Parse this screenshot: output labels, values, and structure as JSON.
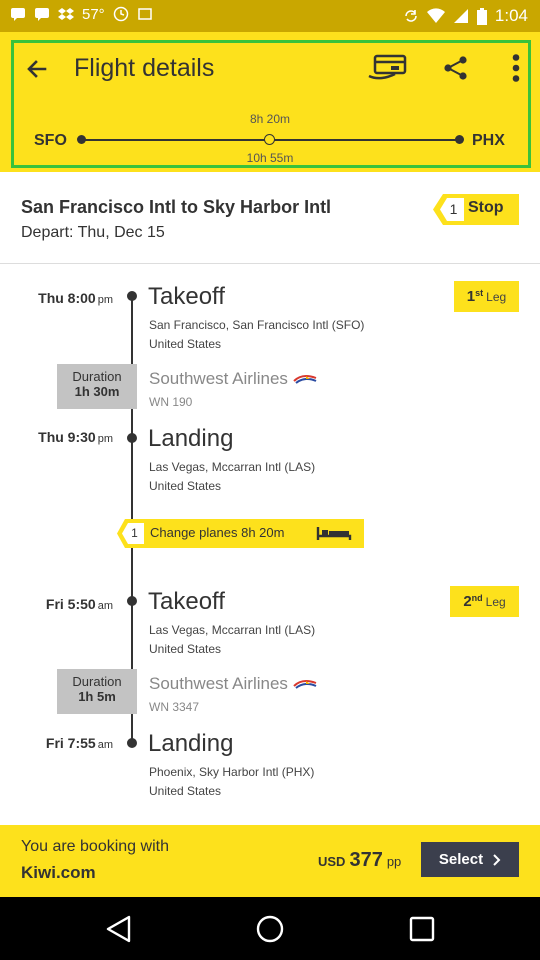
{
  "status_bar": {
    "time": "1:04",
    "left_icons": [
      "message-icon",
      "message-icon",
      "dropbox-icon",
      "temperature-icon",
      "clock-icon",
      "screenshot-icon"
    ],
    "temperature": "57°",
    "right_icons": [
      "sync-icon",
      "wifi-icon",
      "signal-icon",
      "battery-icon"
    ]
  },
  "header": {
    "title": "Flight details",
    "duration_top": "8h 20m",
    "duration_bottom": "10h 55m",
    "origin": "SFO",
    "destination": "PHX",
    "colors": {
      "background": "#fde11c",
      "frame": "#39c23b",
      "statusbar": "#c9a700"
    }
  },
  "summary": {
    "route": "San Francisco Intl to Sky Harbor Intl",
    "depart": "Depart: Thu, Dec 15",
    "stops": "1",
    "stop_label": "Stop"
  },
  "legs": [
    {
      "leg_number": "1",
      "leg_suffix": "st",
      "leg_word": "Leg",
      "takeoff": {
        "day_time": "Thu 8:00",
        "ampm": "pm",
        "event": "Takeoff",
        "airport": "San Francisco, San Francisco Intl (SFO)",
        "country": "United States"
      },
      "duration_label": "Duration",
      "duration_value": "1h 30m",
      "airline": "Southwest Airlines",
      "flight_no": "WN 190",
      "landing": {
        "day_time": "Thu 9:30",
        "ampm": "pm",
        "event": "Landing",
        "airport": "Las Vegas, Mccarran Intl (LAS)",
        "country": "United States"
      }
    },
    {
      "leg_number": "2",
      "leg_suffix": "nd",
      "leg_word": "Leg",
      "takeoff": {
        "day_time": "Fri 5:50",
        "ampm": "am",
        "event": "Takeoff",
        "airport": "Las Vegas, Mccarran Intl (LAS)",
        "country": "United States"
      },
      "duration_label": "Duration",
      "duration_value": "1h 5m",
      "airline": "Southwest Airlines",
      "flight_no": "WN 3347",
      "landing": {
        "day_time": "Fri 7:55",
        "ampm": "am",
        "event": "Landing",
        "airport": "Phoenix, Sky Harbor Intl (PHX)",
        "country": "United States"
      }
    }
  ],
  "change_planes": {
    "count": "1",
    "label": "Change planes",
    "duration": "8h 20m"
  },
  "footer": {
    "booking_label": "You are booking with",
    "booking_site": "Kiwi.com",
    "currency": "USD",
    "price": "377",
    "per_person": "pp",
    "select_label": "Select"
  }
}
